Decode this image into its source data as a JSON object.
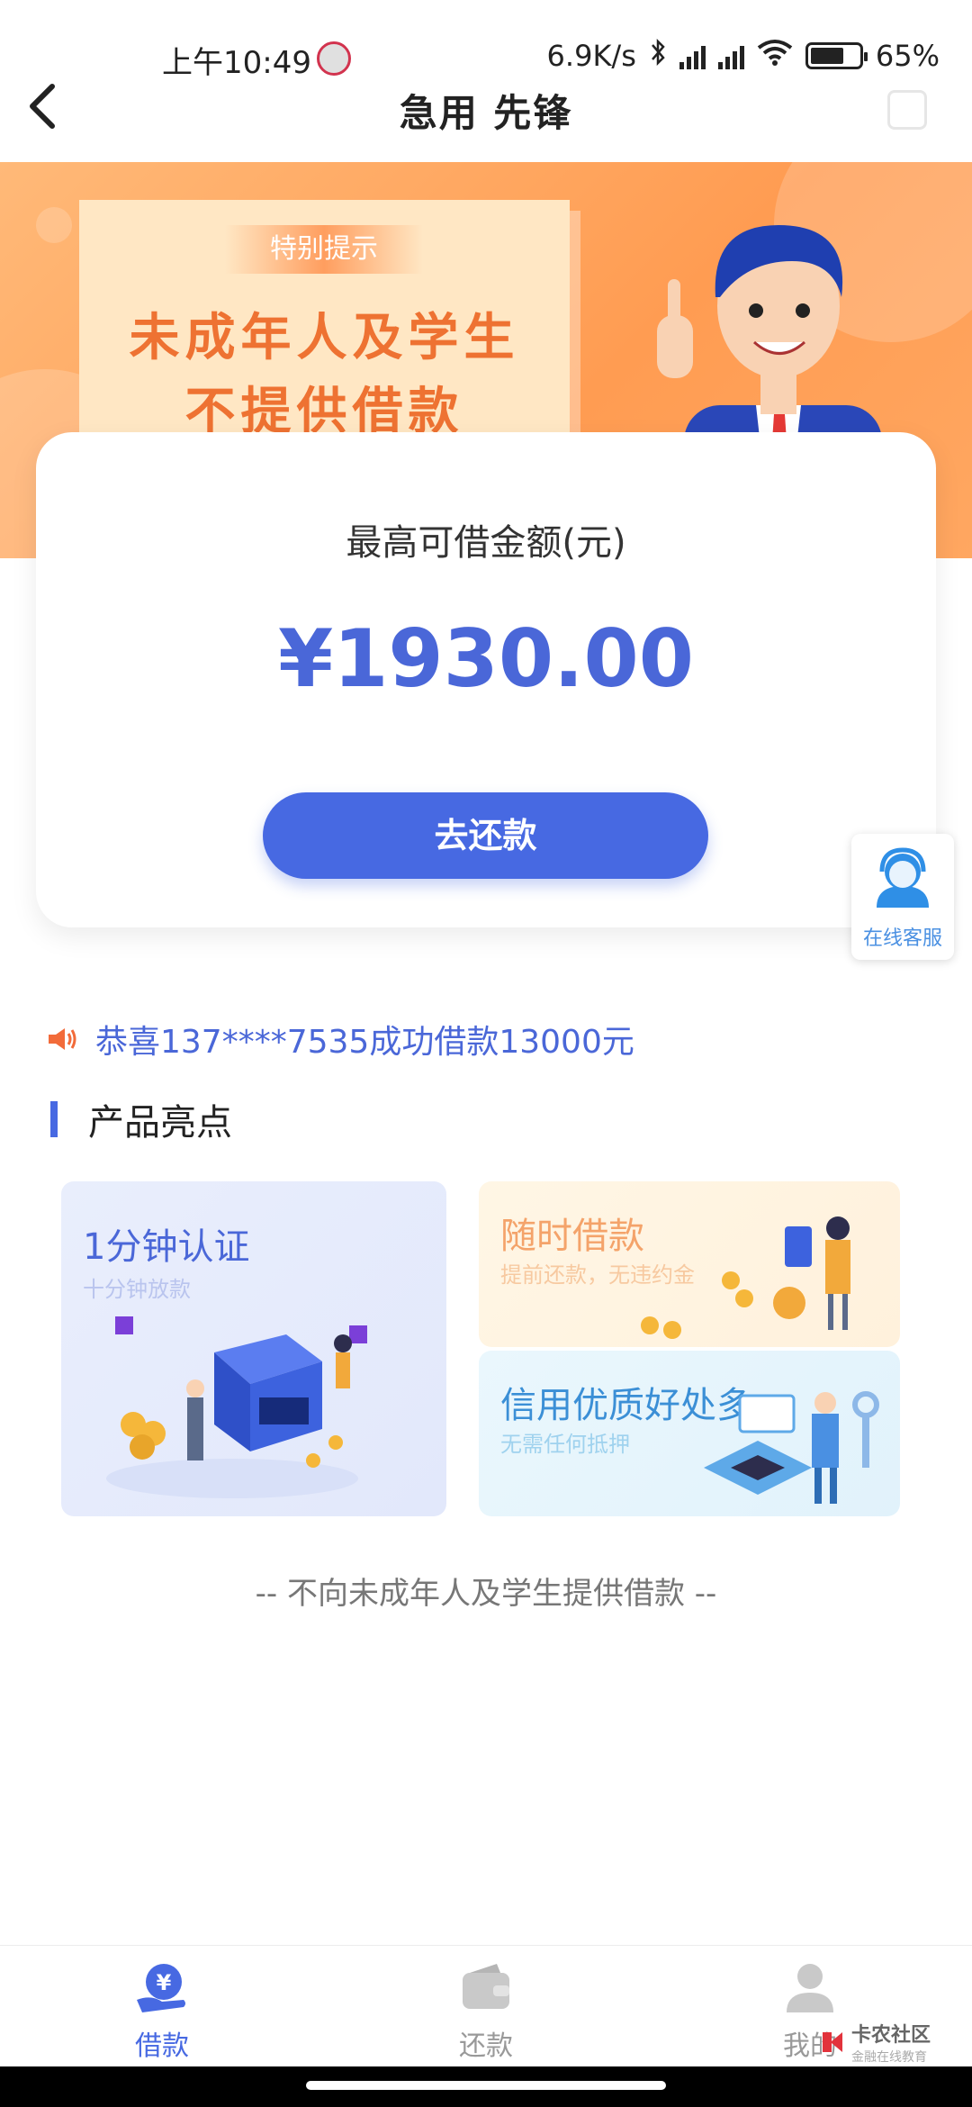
{
  "status_bar": {
    "time": "上午10:49",
    "network_speed": "6.9K/s",
    "battery": "65%"
  },
  "header": {
    "title": "急用 先锋"
  },
  "banner": {
    "tag": "特别提示",
    "line1": "未成年人及学生",
    "line2": "不提供借款"
  },
  "loan_card": {
    "label": "最高可借金额(元)",
    "amount": "¥1930.00",
    "button": "去还款"
  },
  "customer_service": {
    "label": "在线客服"
  },
  "marquee": {
    "text": "恭喜137****7535成功借款13000元"
  },
  "features": {
    "title": "产品亮点",
    "items": [
      {
        "title": "1分钟认证",
        "subtitle": "十分钟放款"
      },
      {
        "title": "随时借款",
        "subtitle": "提前还款，无违约金"
      },
      {
        "title": "信用优质好处多",
        "subtitle": "无需任何抵押"
      }
    ]
  },
  "footer_note": "-- 不向未成年人及学生提供借款 --",
  "tabs": [
    {
      "label": "借款",
      "icon": "yen-hand-icon"
    },
    {
      "label": "还款",
      "icon": "wallet-icon"
    },
    {
      "label": "我的",
      "icon": "user-icon"
    }
  ],
  "watermark": {
    "name": "卡农社区",
    "sub": "金融在线教育"
  },
  "colors": {
    "primary": "#4769e2",
    "banner": "#ff9c52",
    "notice_text": "#ee7232"
  }
}
